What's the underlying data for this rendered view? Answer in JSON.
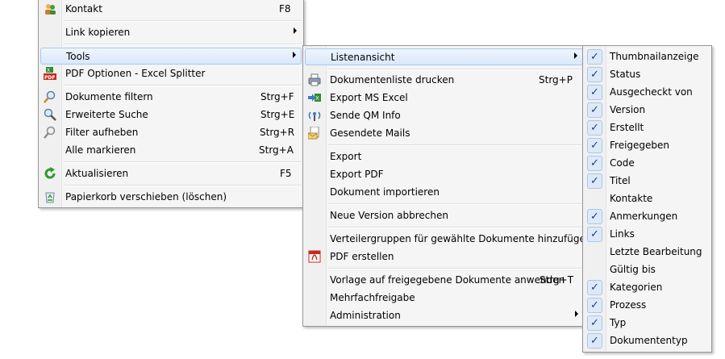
{
  "menu1": {
    "items": [
      {
        "label": "Kontakt",
        "shortcut": "F8",
        "icon": "contact-icon"
      },
      {
        "label": "Link kopieren",
        "submenu": true
      },
      {
        "label": "Tools",
        "submenu": true,
        "highlight": true
      },
      {
        "label": "PDF Optionen - Excel Splitter",
        "icon": "pdf-excel-icon"
      },
      {
        "label": "Dokumente filtern",
        "shortcut": "Strg+F",
        "icon": "filter-magnifier-icon"
      },
      {
        "label": "Erweiterte Suche",
        "shortcut": "Strg+E",
        "icon": "search-icon"
      },
      {
        "label": "Filter aufheben",
        "shortcut": "Strg+R",
        "icon": "clear-filter-icon"
      },
      {
        "label": "Alle markieren",
        "shortcut": "Strg+A"
      },
      {
        "label": "Aktualisieren",
        "shortcut": "F5",
        "icon": "refresh-icon"
      },
      {
        "label": "Papierkorb verschieben (löschen)",
        "icon": "recycle-bin-icon"
      }
    ]
  },
  "menu2": {
    "items": [
      {
        "label": "Listenansicht",
        "submenu": true,
        "highlight": true
      },
      {
        "label": "Dokumentenliste drucken",
        "shortcut": "Strg+P",
        "icon": "printer-icon"
      },
      {
        "label": "Export MS Excel",
        "icon": "excel-export-icon"
      },
      {
        "label": "Sende QM Info",
        "icon": "antenna-icon"
      },
      {
        "label": "Gesendete Mails",
        "icon": "mail-document-icon"
      },
      {
        "label": "Export"
      },
      {
        "label": "Export PDF"
      },
      {
        "label": "Dokument importieren"
      },
      {
        "label": "Neue Version abbrechen"
      },
      {
        "label": "Verteilergruppen für gewählte Dokumente hinzufügen"
      },
      {
        "label": "PDF erstellen",
        "icon": "pdf-icon"
      },
      {
        "label": "Vorlage auf freigegebene Dokumente anwenden",
        "shortcut": "Strg+T"
      },
      {
        "label": "Mehrfachfreigabe"
      },
      {
        "label": "Administration",
        "submenu": true
      }
    ]
  },
  "menu3": {
    "items": [
      {
        "label": "Thumbnailanzeige",
        "checked": true
      },
      {
        "label": "Status",
        "checked": true
      },
      {
        "label": "Ausgecheckt von",
        "checked": true
      },
      {
        "label": "Version",
        "checked": true
      },
      {
        "label": "Erstellt",
        "checked": true
      },
      {
        "label": "Freigegeben",
        "checked": true
      },
      {
        "label": "Code",
        "checked": true
      },
      {
        "label": "Titel",
        "checked": true
      },
      {
        "label": "Kontakte",
        "checked": false
      },
      {
        "label": "Anmerkungen",
        "checked": true
      },
      {
        "label": "Links",
        "checked": true
      },
      {
        "label": "Letzte Bearbeitung",
        "checked": false
      },
      {
        "label": "Gültig bis",
        "checked": false
      },
      {
        "label": "Kategorien",
        "checked": true
      },
      {
        "label": "Prozess",
        "checked": true
      },
      {
        "label": "Typ",
        "checked": true
      },
      {
        "label": "Dokumententyp",
        "checked": true
      }
    ],
    "check_glyph": "✓"
  }
}
